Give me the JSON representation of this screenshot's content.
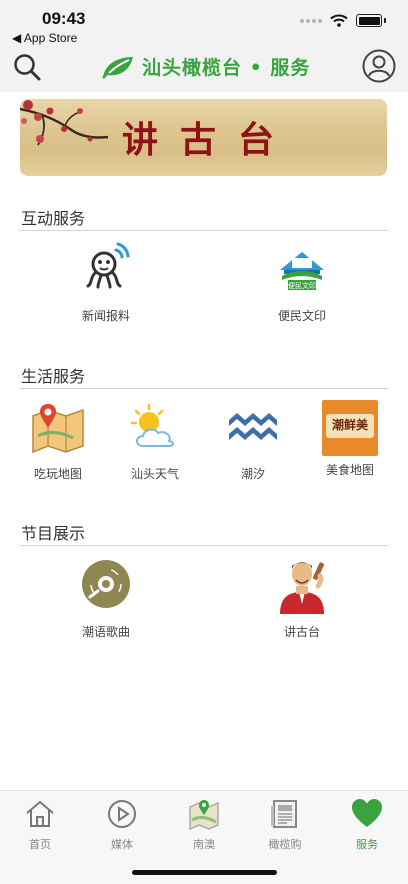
{
  "status_bar": {
    "time": "09:43",
    "back_label": "◀ App Store"
  },
  "nav": {
    "title": "汕头橄榄台 • 服务"
  },
  "banner": {
    "text": "讲古台"
  },
  "sections": [
    {
      "title": "互动服务",
      "items": [
        {
          "label": "新闻报料",
          "icon": "octopus-news-icon"
        },
        {
          "label": "便民文印",
          "icon": "print-service-icon",
          "badge": "便民文印"
        }
      ]
    },
    {
      "title": "生活服务",
      "items": [
        {
          "label": "吃玩地图",
          "icon": "map-pin-icon"
        },
        {
          "label": "汕头天气",
          "icon": "weather-icon"
        },
        {
          "label": "潮汐",
          "icon": "tide-waves-icon"
        },
        {
          "label": "美食地图",
          "icon": "food-map-icon",
          "badge": "潮鲜美"
        }
      ]
    },
    {
      "title": "节目展示",
      "items": [
        {
          "label": "潮语歌曲",
          "icon": "vinyl-record-icon"
        },
        {
          "label": "讲古台",
          "icon": "storyteller-icon"
        }
      ]
    }
  ],
  "tabbar": {
    "items": [
      {
        "label": "首页",
        "icon": "home-icon"
      },
      {
        "label": "媒体",
        "icon": "play-icon"
      },
      {
        "label": "南澳",
        "icon": "map-icon"
      },
      {
        "label": "橄榄购",
        "icon": "newspaper-icon"
      },
      {
        "label": "服务",
        "icon": "heart-icon",
        "active": true
      }
    ]
  },
  "colors": {
    "accent": "#3aa33f",
    "banner_text": "#8e1217"
  }
}
